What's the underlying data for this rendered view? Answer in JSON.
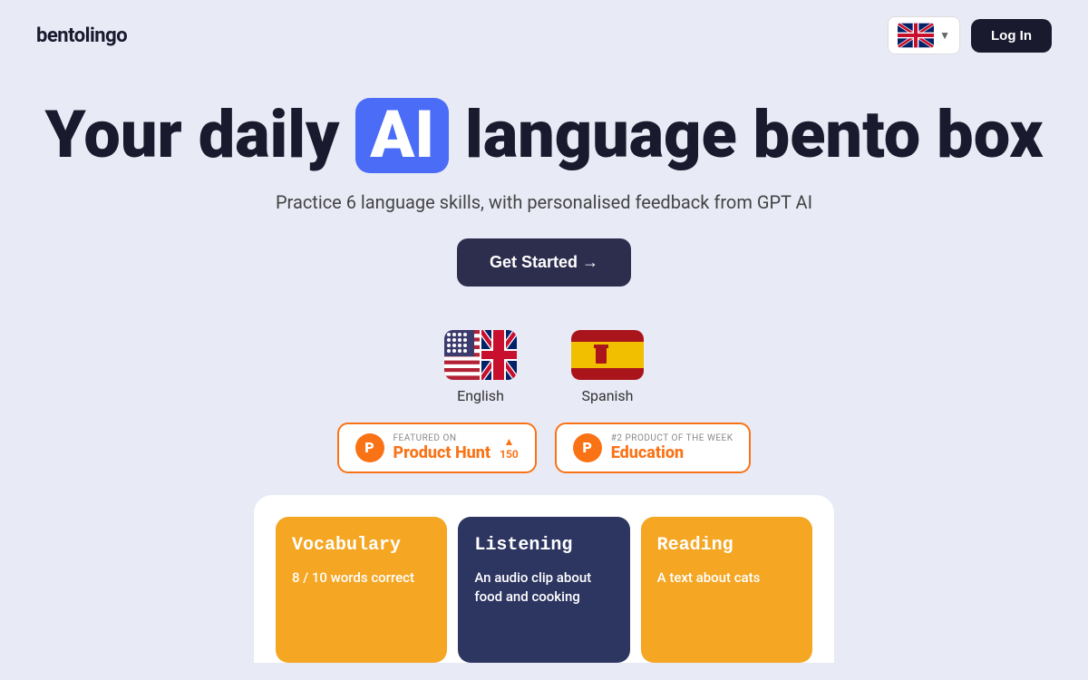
{
  "nav": {
    "logo": "bentolingo",
    "login_label": "Log In",
    "lang_selector_label": "EN"
  },
  "hero": {
    "title_before_ai": "Your daily ",
    "ai_text": "AI",
    "title_after_ai": " language bento box",
    "subtitle": "Practice 6 language skills, with personalised feedback from GPT AI",
    "cta_label": "Get Started →"
  },
  "languages": [
    {
      "name": "English",
      "flag_type": "us_uk"
    },
    {
      "name": "Spanish",
      "flag_type": "es"
    }
  ],
  "product_hunt": [
    {
      "label": "FEATURED ON",
      "name": "Product Hunt",
      "count": "150",
      "arrow": "▲"
    },
    {
      "label": "#2 PRODUCT OF THE WEEK",
      "name": "Education",
      "count": null
    }
  ],
  "bento_cards": [
    {
      "title": "Vocabulary",
      "content": "8 / 10 words correct",
      "style": "orange"
    },
    {
      "title": "Listening",
      "content": "An audio clip about food and cooking",
      "style": "dark"
    },
    {
      "title": "Reading",
      "content": "A text about cats",
      "style": "orange"
    }
  ]
}
